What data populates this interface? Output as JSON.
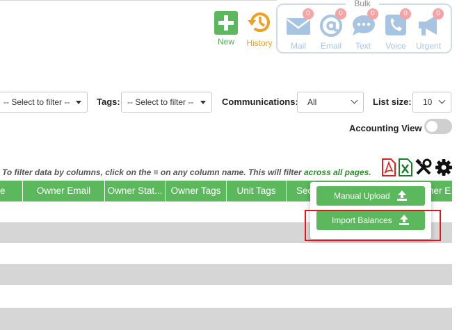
{
  "actions": {
    "new_label": "New",
    "history_label": "History"
  },
  "bulk": {
    "title": "Bulk",
    "items": [
      {
        "label": "Mail",
        "count": "0",
        "icon": "mail-icon"
      },
      {
        "label": "Email",
        "count": "0",
        "icon": "at-icon"
      },
      {
        "label": "Text",
        "count": "0",
        "icon": "chat-icon"
      },
      {
        "label": "Voice",
        "count": "0",
        "icon": "phone-icon"
      },
      {
        "label": "Urgent",
        "count": "0",
        "icon": "megaphone-icon"
      }
    ]
  },
  "filters": {
    "first_select": "-- Select to filter --",
    "tags_label": "Tags:",
    "tags_select": "-- Select to filter --",
    "communications_label": "Communications:",
    "communications_value": "All",
    "list_size_label": "List size:",
    "list_size_value": "10",
    "accounting_view_label": "Accounting View",
    "accounting_view_on": false
  },
  "hint": {
    "text": "To filter data by columns, click on the ≡ on any column name. This will filter ",
    "emphasis": "across all pages."
  },
  "table": {
    "columns": [
      "e",
      "Owner Email",
      "Owner Stat...",
      "Owner Tags",
      "Unit Tags",
      "Sec",
      "ner E"
    ],
    "rows": 6
  },
  "dropdown": {
    "manual_upload": "Manual Upload",
    "import_balances": "Import Balances"
  },
  "colors": {
    "primary_green": "#5cb85c",
    "history_orange": "#f0a020",
    "bulk_blue": "#a8c4e3",
    "highlight_red": "#e8141c"
  }
}
